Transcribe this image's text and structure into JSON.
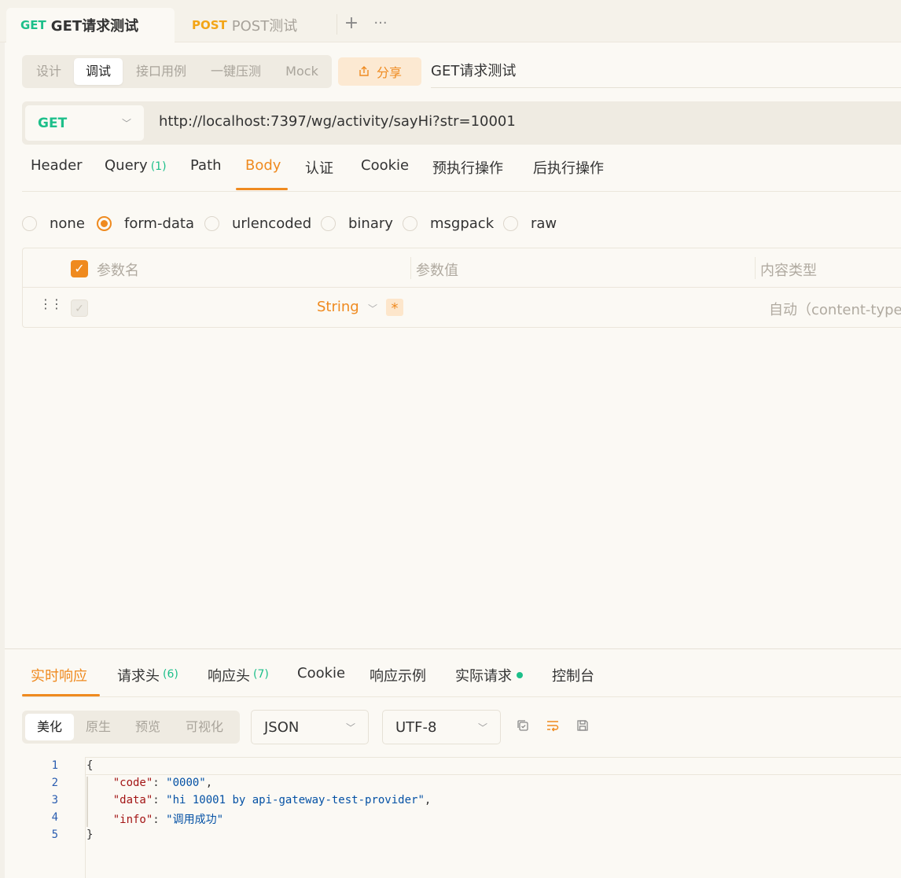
{
  "request_tabs": [
    {
      "method": "GET",
      "title": "GET请求测试",
      "active": true
    },
    {
      "method": "POST",
      "title": "POST测试",
      "active": false
    }
  ],
  "tab_actions": {
    "plus": "+",
    "more": "···"
  },
  "mode_tabs": [
    "设计",
    "调试",
    "接口用例",
    "一键压测",
    "Mock"
  ],
  "mode_active": "调试",
  "share_label": "分享",
  "request_name": "GET请求测试",
  "method": "GET",
  "url": "http://localhost:7397/wg/activity/sayHi?str=10001",
  "param_tabs": [
    {
      "label": "Header"
    },
    {
      "label": "Query",
      "count": "(1)"
    },
    {
      "label": "Path"
    },
    {
      "label": "Body",
      "active": true
    },
    {
      "label": "认证"
    },
    {
      "label": "Cookie"
    },
    {
      "label": "预执行操作"
    },
    {
      "label": "后执行操作"
    }
  ],
  "body_types": [
    "none",
    "form-data",
    "urlencoded",
    "binary",
    "msgpack",
    "raw"
  ],
  "body_type_selected": "form-data",
  "params_table": {
    "headers": [
      "参数名",
      "参数值",
      "内容类型"
    ],
    "row": {
      "type": "String",
      "required_mark": "*",
      "content_type": "自动（content-type"
    }
  },
  "response_tabs": [
    {
      "label": "实时响应",
      "active": true
    },
    {
      "label": "请求头",
      "count": "(6)"
    },
    {
      "label": "响应头",
      "count": "(7)"
    },
    {
      "label": "Cookie"
    },
    {
      "label": "响应示例"
    },
    {
      "label": "实际请求",
      "dot": true
    },
    {
      "label": "控制台"
    }
  ],
  "format_tabs": [
    "美化",
    "原生",
    "预览",
    "可视化"
  ],
  "format_active": "美化",
  "format_select": "JSON",
  "encoding_select": "UTF-8",
  "response_body": {
    "line_numbers": [
      "1",
      "2",
      "3",
      "4",
      "5"
    ],
    "open_brace": "{",
    "close_brace": "}",
    "fields": [
      {
        "key": "\"code\"",
        "value": "\"0000\"",
        "trail": ","
      },
      {
        "key": "\"data\"",
        "value": "\"hi 10001 by api-gateway-test-provider\"",
        "trail": ","
      },
      {
        "key": "\"info\"",
        "value": "\"调用成功\"",
        "trail": ""
      }
    ]
  },
  "colors": {
    "accent": "#ef8a1f",
    "get": "#1dbf8a",
    "post": "#f3a516"
  }
}
